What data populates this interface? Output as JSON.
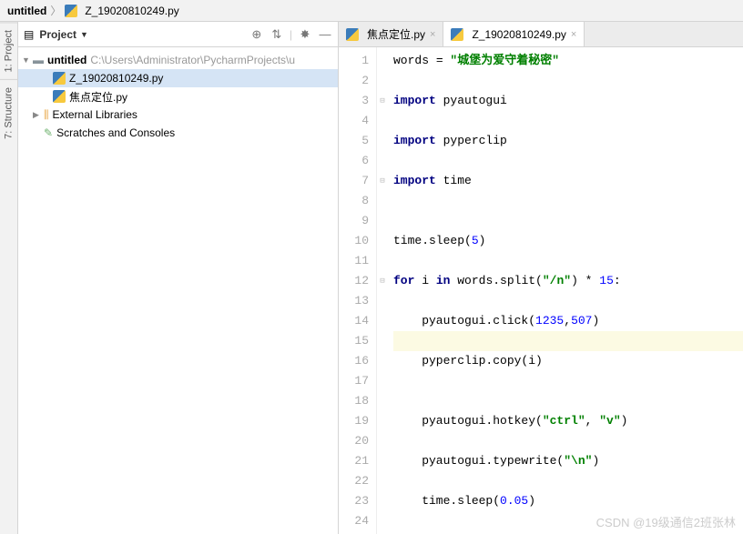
{
  "breadcrumb": {
    "root": "untitled",
    "file": "Z_19020810249.py"
  },
  "sidebar_tabs": {
    "project": "1: Project",
    "structure": "7: Structure"
  },
  "panel": {
    "title": "Project",
    "icons": {
      "target": "⊕",
      "expand": "⇅",
      "settings": "✸",
      "collapse": "—"
    }
  },
  "tree": {
    "root": {
      "name": "untitled",
      "path": "C:\\Users\\Administrator\\PycharmProjects\\u"
    },
    "files": [
      "Z_19020810249.py",
      "焦点定位.py"
    ],
    "ext_libs": "External Libraries",
    "scratches": "Scratches and Consoles"
  },
  "tabs": [
    {
      "label": "焦点定位.py",
      "active": false
    },
    {
      "label": "Z_19020810249.py",
      "active": true
    }
  ],
  "code": {
    "line_start": 1,
    "line_count": 24,
    "current_line": 15,
    "lines": [
      {
        "t": [
          [
            "",
            "words "
          ],
          [
            "op",
            "= "
          ],
          [
            "str",
            "\"城堡为爱守着秘密\""
          ]
        ],
        "fold": ""
      },
      {
        "t": [
          [
            "",
            ""
          ]
        ],
        "fold": ""
      },
      {
        "t": [
          [
            "kw",
            "import "
          ],
          [
            "",
            "pyautogui"
          ]
        ],
        "fold": "-"
      },
      {
        "t": [
          [
            "",
            ""
          ]
        ],
        "fold": ""
      },
      {
        "t": [
          [
            "kw",
            "import "
          ],
          [
            "",
            "pyperclip"
          ]
        ],
        "fold": ""
      },
      {
        "t": [
          [
            "",
            ""
          ]
        ],
        "fold": ""
      },
      {
        "t": [
          [
            "kw",
            "import "
          ],
          [
            "",
            "time"
          ]
        ],
        "fold": "-"
      },
      {
        "t": [
          [
            "",
            ""
          ]
        ],
        "fold": ""
      },
      {
        "t": [
          [
            "",
            ""
          ]
        ],
        "fold": ""
      },
      {
        "t": [
          [
            "",
            "time.sleep("
          ],
          [
            "num",
            "5"
          ],
          [
            "",
            ")"
          ]
        ],
        "fold": ""
      },
      {
        "t": [
          [
            "",
            ""
          ]
        ],
        "fold": ""
      },
      {
        "t": [
          [
            "kw",
            "for "
          ],
          [
            "",
            "i "
          ],
          [
            "kw",
            "in "
          ],
          [
            "",
            "words.split("
          ],
          [
            "str",
            "\"/n\""
          ],
          [
            "",
            ") * "
          ],
          [
            "num",
            "15"
          ],
          [
            "",
            ":"
          ]
        ],
        "fold": "-"
      },
      {
        "t": [
          [
            "",
            ""
          ]
        ],
        "fold": ""
      },
      {
        "t": [
          [
            "",
            "    pyautogui.click("
          ],
          [
            "num",
            "1235"
          ],
          [
            "",
            ","
          ],
          [
            "num",
            "507"
          ],
          [
            "",
            ")"
          ]
        ],
        "fold": ""
      },
      {
        "t": [
          [
            "",
            ""
          ]
        ],
        "fold": ""
      },
      {
        "t": [
          [
            "",
            "    pyperclip.copy(i)"
          ]
        ],
        "fold": ""
      },
      {
        "t": [
          [
            "",
            ""
          ]
        ],
        "fold": ""
      },
      {
        "t": [
          [
            "",
            ""
          ]
        ],
        "fold": ""
      },
      {
        "t": [
          [
            "",
            "    pyautogui.hotkey("
          ],
          [
            "str",
            "\"ctrl\""
          ],
          [
            "",
            ", "
          ],
          [
            "str",
            "\"v\""
          ],
          [
            "",
            ")"
          ]
        ],
        "fold": ""
      },
      {
        "t": [
          [
            "",
            ""
          ]
        ],
        "fold": ""
      },
      {
        "t": [
          [
            "",
            "    pyautogui.typewrite("
          ],
          [
            "str",
            "\"\\n\""
          ],
          [
            "",
            ")"
          ]
        ],
        "fold": ""
      },
      {
        "t": [
          [
            "",
            ""
          ]
        ],
        "fold": ""
      },
      {
        "t": [
          [
            "",
            "    time.sleep("
          ],
          [
            "num",
            "0.05"
          ],
          [
            "",
            ")"
          ]
        ],
        "fold": ""
      },
      {
        "t": [
          [
            "",
            ""
          ]
        ],
        "fold": ""
      }
    ]
  },
  "watermark": "CSDN @19级通信2班张林"
}
